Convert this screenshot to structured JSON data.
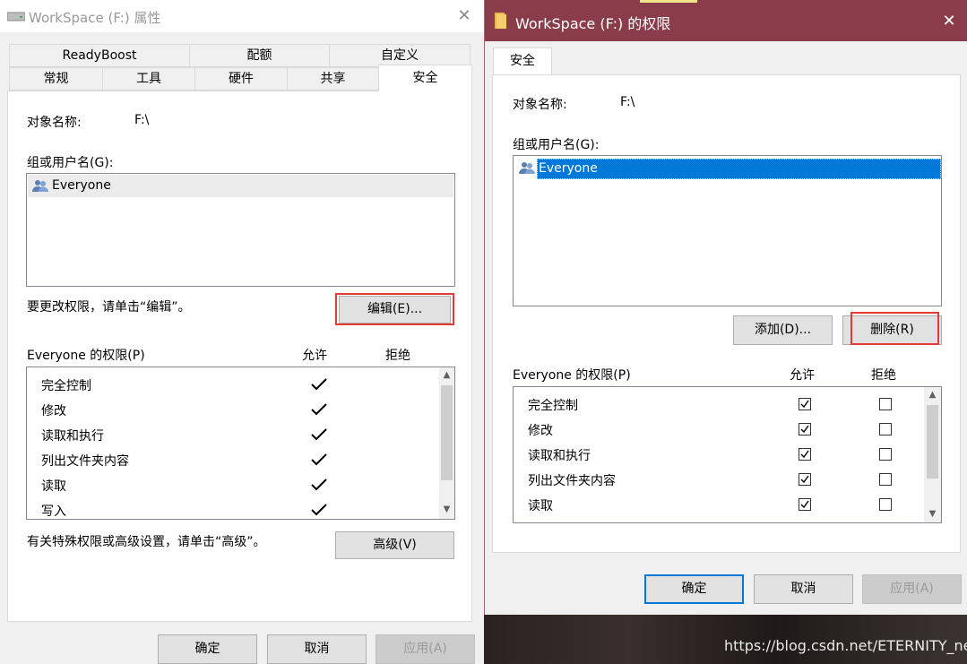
{
  "left_window": {
    "title": "WorkSpace (F:) 属性",
    "tabs_row1": [
      "ReadyBoost",
      "配额",
      "自定义"
    ],
    "tabs_row2": [
      "常规",
      "工具",
      "硬件",
      "共享",
      "安全"
    ],
    "object_name_label": "对象名称:",
    "object_name_value": "F:\\",
    "group_label": "组或用户名(G):",
    "users": [
      "Everyone"
    ],
    "change_hint": "要更改权限，请单击“编辑”。",
    "edit_button": "编辑(E)...",
    "perm_title": "Everyone 的权限(P)",
    "allow_header": "允许",
    "deny_header": "拒绝",
    "permissions": [
      {
        "name": "完全控制",
        "allow": true,
        "deny": false
      },
      {
        "name": "修改",
        "allow": true,
        "deny": false
      },
      {
        "name": "读取和执行",
        "allow": true,
        "deny": false
      },
      {
        "name": "列出文件夹内容",
        "allow": true,
        "deny": false
      },
      {
        "name": "读取",
        "allow": true,
        "deny": false
      },
      {
        "name": "写入",
        "allow": true,
        "deny": false
      }
    ],
    "advanced_hint": "有关特殊权限或高级设置，请单击“高级”。",
    "advanced_button": "高级(V)",
    "ok_button": "确定",
    "cancel_button": "取消",
    "apply_button": "应用(A)"
  },
  "right_window": {
    "title": "WorkSpace (F:) 的权限",
    "tab": "安全",
    "object_name_label": "对象名称:",
    "object_name_value": "F:\\",
    "group_label": "组或用户名(G):",
    "users": [
      "Everyone"
    ],
    "add_button": "添加(D)...",
    "remove_button": "删除(R)",
    "perm_title": "Everyone 的权限(P)",
    "allow_header": "允许",
    "deny_header": "拒绝",
    "permissions": [
      {
        "name": "完全控制",
        "allow": true,
        "deny": false
      },
      {
        "name": "修改",
        "allow": true,
        "deny": false
      },
      {
        "name": "读取和执行",
        "allow": true,
        "deny": false
      },
      {
        "name": "列出文件夹内容",
        "allow": true,
        "deny": false
      },
      {
        "name": "读取",
        "allow": true,
        "deny": false
      }
    ],
    "ok_button": "确定",
    "cancel_button": "取消",
    "apply_button": "应用(A)"
  },
  "watermark": "https://blog.csdn.net/ETERNITY_neu",
  "colors": {
    "title_active": "#8b3c4b",
    "selection": "#0078d7",
    "highlight_border": "#e53935"
  }
}
